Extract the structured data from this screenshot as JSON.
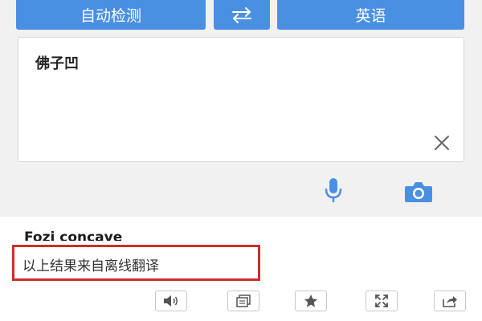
{
  "lang_bar": {
    "source_lang": "自动检测",
    "swap_icon": "swap-arrows-icon",
    "target_lang": "英语"
  },
  "input": {
    "text": "佛子凹",
    "clear_icon": "close-icon"
  },
  "input_tools": {
    "mic_icon": "microphone-icon",
    "camera_icon": "camera-icon"
  },
  "result": {
    "text": "Fozi concave",
    "notice": "以上结果来自离线翻译"
  },
  "toolbar": {
    "icons": [
      "speaker-icon",
      "copy-icon",
      "star-icon",
      "fullscreen-icon",
      "share-icon"
    ]
  },
  "colors": {
    "accent": "#4a90e2",
    "highlight_border": "#c9302c",
    "panel_bg": "#f1f1f1"
  }
}
